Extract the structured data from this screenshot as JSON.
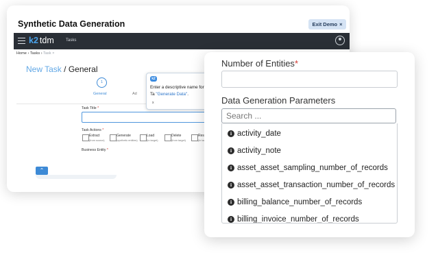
{
  "header": {
    "title": "Synthetic Data Generation",
    "exit_button": "Exit Demo",
    "exit_icon": "×"
  },
  "app": {
    "logo_k2": "k2",
    "logo_tdm": "tdm",
    "nav_tasks": "Tasks",
    "breadcrumb": {
      "home": "Home",
      "sep": "›",
      "tasks": "Tasks",
      "current": "Task ×"
    },
    "page_title_prefix": "New Task",
    "page_title_sep": " / ",
    "page_title_suffix": "General"
  },
  "wizard": {
    "step_number": "1",
    "step_label": "General",
    "step_next": "Ad"
  },
  "form": {
    "task_title_label": "Task Title",
    "task_actions_label": "Task Actions",
    "business_entity_label": "Business Entity",
    "required_mark": "*",
    "actions": [
      {
        "label": "Extract",
        "sub": "(from source)"
      },
      {
        "label": "Generate",
        "sub": "(synthetic entities)"
      },
      {
        "label": "Load",
        "sub": "(to target)"
      },
      {
        "label": "Delete",
        "sub": "(from target)"
      },
      {
        "label": "Reserve",
        "sub": "(in target)"
      }
    ],
    "collapse_icon": "⌃"
  },
  "tooltip": {
    "logo": "k2",
    "text_prefix": "Enter a descriptive name for the Ta",
    "text_highlight": "\"Generate Data\"",
    "text_suffix": ".",
    "close": "x"
  },
  "params_panel": {
    "entities_label": "Number of Entities",
    "required_mark": "*",
    "params_label": "Data Generation Parameters",
    "search_placeholder": "Search ...",
    "info_glyph": "i",
    "items": [
      "activity_date",
      "activity_note",
      "asset_asset_sampling_number_of_records",
      "asset_asset_transaction_number_of_records",
      "billing_balance_number_of_records",
      "billing_invoice_number_of_records"
    ]
  }
}
